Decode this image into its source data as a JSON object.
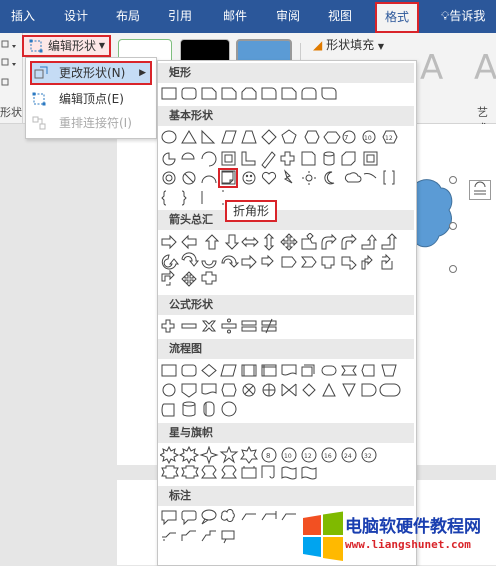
{
  "tabs": [
    "插入",
    "设计",
    "布局",
    "引用",
    "邮件",
    "审阅",
    "视图",
    "格式"
  ],
  "active_tab": "格式",
  "tell_me": "告诉我",
  "ribbon": {
    "edit_shape_label": "编辑形状",
    "shape_fill_label": "形状填充",
    "left_group_label": "形状",
    "art_group_label": "艺术",
    "big_a": "A"
  },
  "edit_menu": {
    "items": [
      {
        "label": "更改形状(N)",
        "active": true
      },
      {
        "label": "编辑顶点(E)",
        "active": false
      },
      {
        "label": "重排连接符(I)",
        "disabled": true
      }
    ]
  },
  "gallery": {
    "categories": [
      "矩形",
      "基本形状",
      "箭头总汇",
      "公式形状",
      "流程图",
      "星与旗帜",
      "标注"
    ],
    "tooltip": "折角形"
  },
  "watermark": {
    "title": "电脑软硬件教程网",
    "url": "www.liangshunet.com"
  },
  "colors": {
    "tab_bar": "#2b579a",
    "highlight_red": "#d9242a",
    "cloud_blue": "#5b9bd5"
  }
}
